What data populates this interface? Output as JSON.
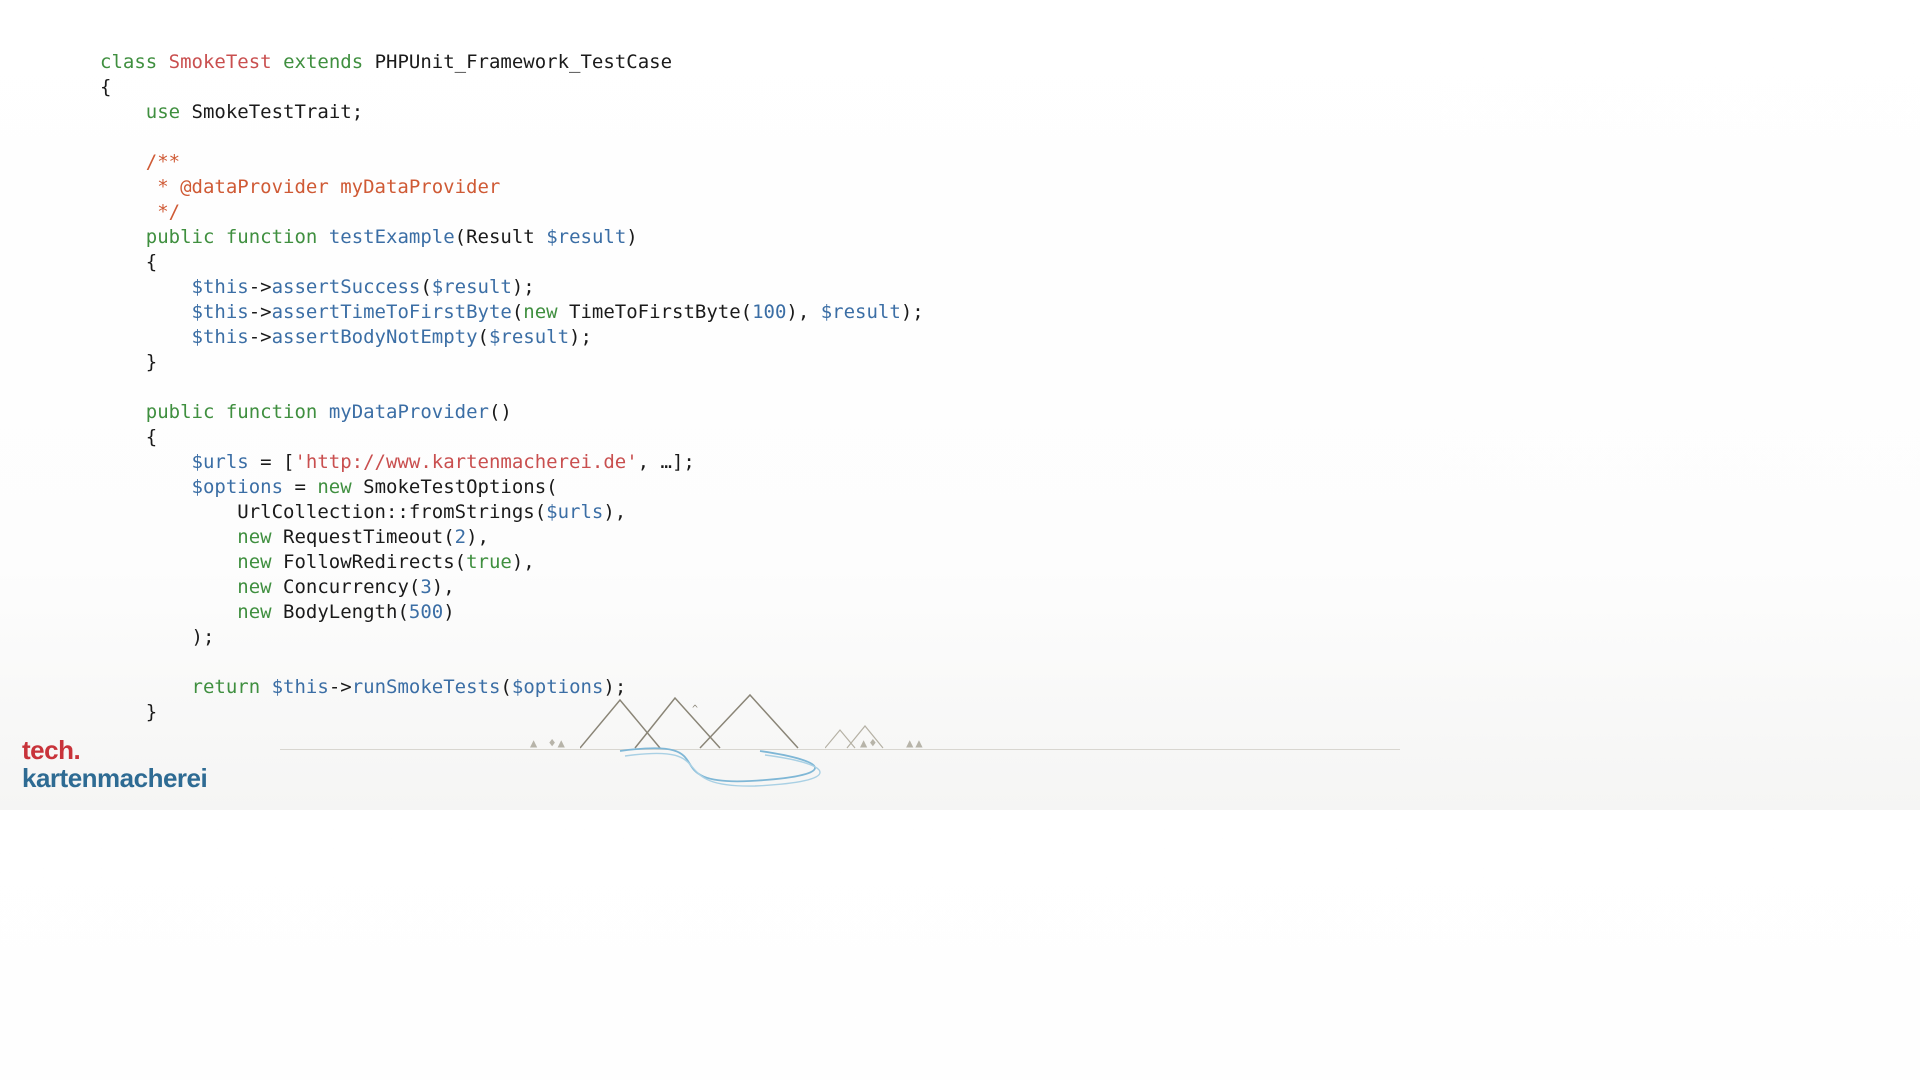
{
  "code": {
    "l1_class": "class",
    "l1_name": "SmokeTest",
    "l1_extends": "extends",
    "l1_base": "PHPUnit_Framework_TestCase",
    "l2": "{",
    "l3_use": "use",
    "l3_trait": "SmokeTestTrait;",
    "c1": "/**",
    "c2": " * @dataProvider myDataProvider",
    "c3": " */",
    "f1_pub": "public",
    "f1_func": "function",
    "f1_name": "testExample",
    "f1_sig_open": "(Result ",
    "f1_arg": "$result",
    "f1_sig_close": ")",
    "f1_open": "{",
    "a1_this": "$this",
    "a1_arrow": "->",
    "a1_fn": "assertSuccess",
    "a1_open": "(",
    "a1_arg": "$result",
    "a1_close": ");",
    "a2_this": "$this",
    "a2_arrow": "->",
    "a2_fn": "assertTimeToFirstByte",
    "a2_open": "(",
    "a2_new": "new",
    "a2_cls": " TimeToFirstByte(",
    "a2_num": "100",
    "a2_mid": "), ",
    "a2_arg": "$result",
    "a2_close": ");",
    "a3_this": "$this",
    "a3_arrow": "->",
    "a3_fn": "assertBodyNotEmpty",
    "a3_open": "(",
    "a3_arg": "$result",
    "a3_close": ");",
    "f1_close": "}",
    "f2_pub": "public",
    "f2_func": "function",
    "f2_name": "myDataProvider",
    "f2_sig": "()",
    "f2_open": "{",
    "u_var": "$urls",
    "u_eq": " = [",
    "u_str": "'http://www.kartenmacherei.de'",
    "u_rest": ", …];",
    "o_var": "$options",
    "o_eq": " = ",
    "o_new": "new",
    "o_cls": " SmokeTestOptions(",
    "uc_txt": "UrlCollection::fromStrings(",
    "uc_arg": "$urls",
    "uc_close": "),",
    "rt_new": "new",
    "rt_txt": " RequestTimeout(",
    "rt_num": "2",
    "rt_close": "),",
    "fr_new": "new",
    "fr_txt": " FollowRedirects(",
    "fr_val": "true",
    "fr_close": "),",
    "cc_new": "new",
    "cc_txt": " Concurrency(",
    "cc_num": "3",
    "cc_close": "),",
    "bl_new": "new",
    "bl_txt": " BodyLength(",
    "bl_num": "500",
    "bl_close": ")",
    "o_close": ");",
    "ret_kw": "return",
    "ret_this": "$this",
    "ret_arrow": "->",
    "ret_fn": "runSmokeTests",
    "ret_open": "(",
    "ret_arg": "$options",
    "ret_close": ");",
    "f2_close": "}"
  },
  "logo": {
    "line1": "tech.",
    "line2": "kartenmacherei"
  }
}
